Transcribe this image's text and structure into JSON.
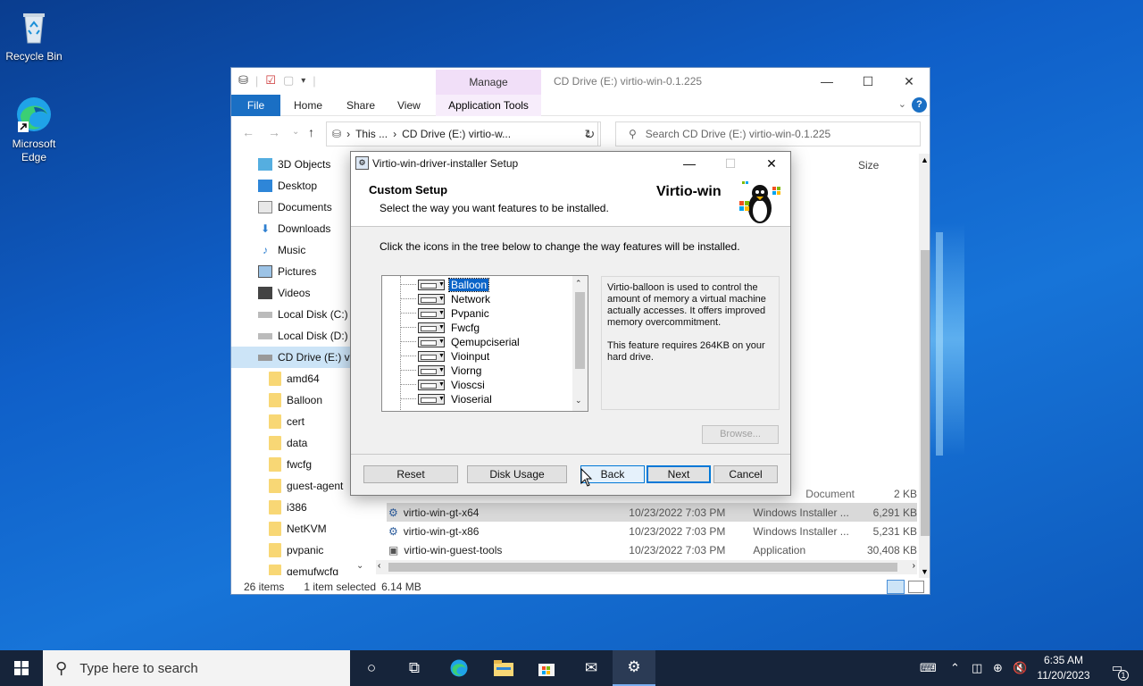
{
  "desktop": {
    "icons": [
      {
        "label": "Recycle Bin"
      },
      {
        "label": "Microsoft Edge"
      }
    ]
  },
  "explorer": {
    "title": "CD Drive (E:) virtio-win-0.1.225",
    "manage_tab": "Manage",
    "ribbon_tabs": {
      "file": "File",
      "home": "Home",
      "share": "Share",
      "view": "View",
      "app_tools": "Application Tools"
    },
    "address": {
      "part1": "This ...",
      "part2": "CD Drive (E:) virtio-w..."
    },
    "search_placeholder": "Search CD Drive (E:) virtio-win-0.1.225",
    "nav_items": [
      {
        "label": "3D Objects"
      },
      {
        "label": "Desktop"
      },
      {
        "label": "Documents"
      },
      {
        "label": "Downloads"
      },
      {
        "label": "Music"
      },
      {
        "label": "Pictures"
      },
      {
        "label": "Videos"
      },
      {
        "label": "Local Disk (C:)"
      },
      {
        "label": "Local Disk (D:)"
      },
      {
        "label": "CD Drive (E:) vir"
      },
      {
        "label": "amd64"
      },
      {
        "label": "Balloon"
      },
      {
        "label": "cert"
      },
      {
        "label": "data"
      },
      {
        "label": "fwcfg"
      },
      {
        "label": "guest-agent"
      },
      {
        "label": "i386"
      },
      {
        "label": "NetKVM"
      },
      {
        "label": "pvpanic"
      },
      {
        "label": "qemufwcfg"
      }
    ],
    "column_size": "Size",
    "files": [
      {
        "name": "virtio-win-gt-x64",
        "date": "10/23/2022 7:03 PM",
        "type": "Windows Installer ...",
        "size": "6,291 KB"
      },
      {
        "name": "virtio-win-gt-x86",
        "date": "10/23/2022 7:03 PM",
        "type": "Windows Installer ...",
        "size": "5,231 KB"
      },
      {
        "name": "virtio-win-guest-tools",
        "date": "10/23/2022 7:03 PM",
        "type": "Application",
        "size": "30,408 KB"
      }
    ],
    "partial_row": {
      "type": "Document",
      "size": "2 KB"
    },
    "status": {
      "items": "26 items",
      "selected": "1 item selected",
      "size": "6.14 MB"
    }
  },
  "dialog": {
    "title": "Virtio-win-driver-installer Setup",
    "heading": "Custom Setup",
    "subheading": "Select the way you want features to be installed.",
    "brand": "Virtio-win",
    "instruction": "Click the icons in the tree below to change the way features will be installed.",
    "features": [
      {
        "label": "Balloon"
      },
      {
        "label": "Network"
      },
      {
        "label": "Pvpanic"
      },
      {
        "label": "Fwcfg"
      },
      {
        "label": "Qemupciserial"
      },
      {
        "label": "Vioinput"
      },
      {
        "label": "Viorng"
      },
      {
        "label": "Vioscsi"
      },
      {
        "label": "Vioserial"
      }
    ],
    "description": "Virtio-balloon is used to control the amount of memory a virtual machine actually accesses. It offers improved memory overcommitment.",
    "requirement": "This feature requires 264KB on your hard drive.",
    "buttons": {
      "browse": "Browse...",
      "reset": "Reset",
      "disk_usage": "Disk Usage",
      "back": "Back",
      "next": "Next",
      "cancel": "Cancel"
    }
  },
  "taskbar": {
    "search_placeholder": "Type here to search",
    "time": "6:35 AM",
    "date": "11/20/2023",
    "notification_count": "1"
  },
  "colors": {
    "accent": "#0078d7",
    "selection": "#0a64c8",
    "taskbar": "#16243a",
    "manage_tab": "#f1dff8"
  }
}
